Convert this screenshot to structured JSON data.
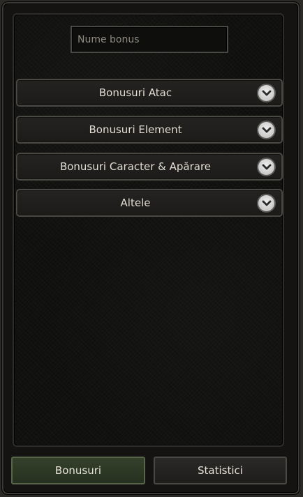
{
  "search": {
    "placeholder": "Nume bonus",
    "value": ""
  },
  "categories": [
    {
      "label": "Bonusuri Atac",
      "icon": "chevron-down-icon"
    },
    {
      "label": "Bonusuri Element",
      "icon": "chevron-down-icon"
    },
    {
      "label": "Bonusuri Caracter & Apărare",
      "icon": "chevron-down-icon"
    },
    {
      "label": "Altele",
      "icon": "chevron-down-icon"
    }
  ],
  "tabs": {
    "bonuses_label": "Bonusuri",
    "stats_label": "Statistici",
    "active": "Bonusuri"
  },
  "colors": {
    "active_tab": "#34412b",
    "panel_bg": "#111110",
    "text": "#e2ddd3"
  }
}
